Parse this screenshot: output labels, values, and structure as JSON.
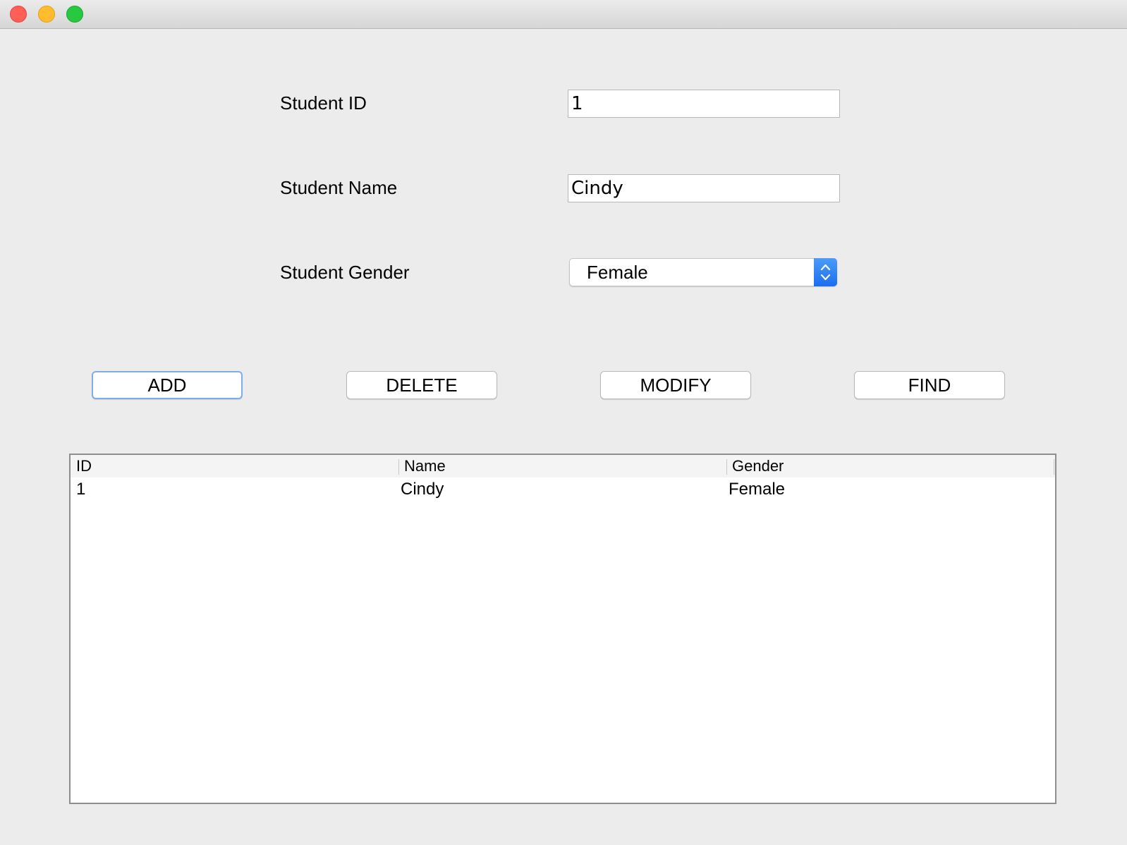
{
  "form": {
    "id_label": "Student ID",
    "id_value": "1",
    "name_label": "Student Name",
    "name_value": "Cindy",
    "gender_label": "Student Gender",
    "gender_value": "Female"
  },
  "buttons": {
    "add": "ADD",
    "delete": "DELETE",
    "modify": "MODIFY",
    "find": "FIND"
  },
  "table": {
    "columns": [
      "ID",
      "Name",
      "Gender"
    ],
    "rows": [
      [
        "1",
        "Cindy",
        "Female"
      ]
    ]
  },
  "colors": {
    "accent": "#1a6ef0",
    "focus_ring": "#7eaee8"
  }
}
